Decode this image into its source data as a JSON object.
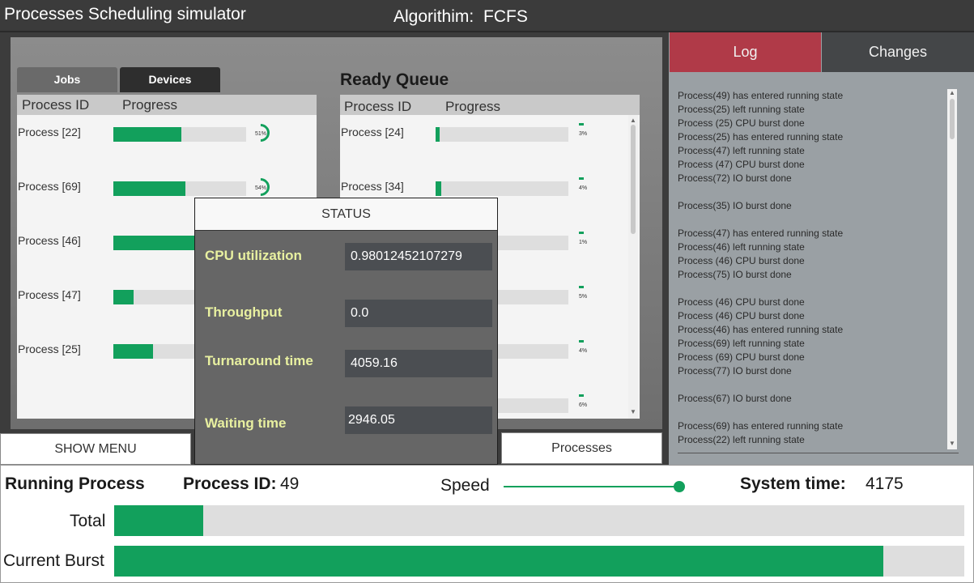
{
  "window": {
    "title": "Processes Scheduling simulator",
    "algorithm_label": "Algorithim:",
    "algorithm_value": "FCFS"
  },
  "tabs": {
    "jobs": "Jobs",
    "devices": "Devices"
  },
  "jobs_list": {
    "headers": [
      "Process ID",
      "Progress"
    ],
    "rows": [
      {
        "label": "Process [22]",
        "progress": 0.51,
        "pct": "51%"
      },
      {
        "label": "Process [69]",
        "progress": 0.54,
        "pct": "54%"
      },
      {
        "label": "Process [46]",
        "progress": 0.62,
        "pct": ""
      },
      {
        "label": "Process [47]",
        "progress": 0.15,
        "pct": ""
      },
      {
        "label": "Process [25]",
        "progress": 0.3,
        "pct": ""
      }
    ]
  },
  "ready_queue": {
    "title": "Ready Queue",
    "headers": [
      "Process ID",
      "Progress"
    ],
    "rows": [
      {
        "label": "Process [24]",
        "progress": 0.03,
        "pct": "3%"
      },
      {
        "label": "Process [34]",
        "progress": 0.04,
        "pct": "4%"
      },
      {
        "label": "",
        "progress": 0.01,
        "pct": "1%"
      },
      {
        "label": "",
        "progress": 0.05,
        "pct": "5%"
      },
      {
        "label": "",
        "progress": 0.04,
        "pct": "4%"
      },
      {
        "label": "",
        "progress": 0.06,
        "pct": "6%"
      }
    ]
  },
  "status": {
    "title": "STATUS",
    "cpu_label": "CPU utilization",
    "cpu_value": "0.98012452107279",
    "throughput_label": "Throughput",
    "throughput_value": "0.0",
    "turnaround_label": "Turnaround time",
    "turnaround_value": "4059.16",
    "waiting_label": "Waiting time",
    "waiting_value": "2946.05"
  },
  "buttons": {
    "show_menu": "SHOW MENU",
    "processes": "Processes"
  },
  "log_panel": {
    "tab_log": "Log",
    "tab_changes": "Changes",
    "lines": [
      "Process(49) has entered running state",
      "Process(25) left running state",
      "Process (25)  CPU burst done",
      "Process(25) has entered running state",
      "Process(47) left running state",
      "Process (47)  CPU burst done",
      "Process(72)  IO burst done",
      "",
      "Process(35)  IO burst done",
      "",
      "Process(47) has entered running state",
      "Process(46) left running state",
      "Process (46)  CPU burst done",
      "Process(75)  IO burst done",
      "",
      "Process (46)  CPU burst done",
      "Process (46)  CPU burst done",
      "Process(46) has entered running state",
      "Process(69) left running state",
      "Process (69)  CPU burst done",
      "Process(77)  IO burst done",
      "",
      "Process(67)  IO burst done",
      "",
      "Process(69) has entered running state",
      "Process(22) left running state"
    ]
  },
  "running": {
    "title": "Running Process",
    "pid_label": "Process ID:",
    "pid_value": "49",
    "speed_label": "Speed",
    "speed_level": 1.0,
    "systime_label": "System time:",
    "systime_value": "4175",
    "total_label": "Total",
    "total_progress": 0.105,
    "burst_label": "Current Burst",
    "burst_progress": 0.905
  },
  "colors": {
    "accent_green": "#12a05c",
    "log_tab_red": "#b03a48",
    "status_label": "#e8f0a0"
  }
}
